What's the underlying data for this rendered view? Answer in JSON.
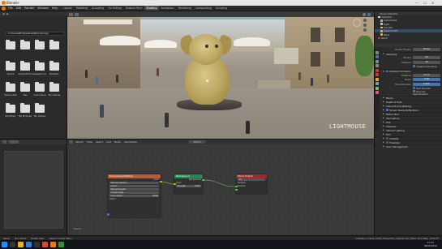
{
  "window": {
    "title": "Blender"
  },
  "window_controls": [
    "—",
    "☐",
    "✕"
  ],
  "menu": {
    "items": [
      "File",
      "Edit",
      "Render",
      "Window",
      "Help"
    ],
    "workspaces": [
      "Layout",
      "Modeling",
      "Sculpting",
      "UV Editing",
      "Texture Paint",
      "Shading",
      "Animation",
      "Rendering",
      "Compositing",
      "Scripting"
    ],
    "active_workspace": "Shading"
  },
  "file_browser": {
    "path": "C:\\Users\\Elli\\Desktop\\Blendering\\",
    "folders": [
      "",
      "",
      "",
      "",
      "Adobe",
      "AntiqueFolio",
      "Assassin's C...",
      "Bubbles",
      "Downloads",
      "iTax",
      "Insomnium",
      "My Games",
      "My Music",
      "My Pictures",
      "My Videos",
      "",
      "",
      ""
    ]
  },
  "viewport": {
    "watermark": "LIGHTMOUSE",
    "icons": [
      "select-box-icon",
      "view-icon",
      "shading-solid-icon",
      "shading-rendered-icon"
    ]
  },
  "outliner": {
    "header": "Scene Collection",
    "rows": [
      "Collection",
      "Camera.001",
      "Light",
      "Sun.001",
      "Suzanne.001",
      "Plane",
      "World"
    ]
  },
  "properties": {
    "render_engine_label": "Render Engine",
    "render_engine": "Eevee",
    "sampling": {
      "title": "Sampling",
      "render_label": "Render",
      "render_value": "64",
      "viewport_label": "Viewport",
      "viewport_value": "16",
      "denoise_label": "Viewport Denoising"
    },
    "ao": {
      "title": "Ambient Occlusion",
      "distance_label": "Distance",
      "distance_value": "0.2 m",
      "factor_label": "Factor",
      "factor_value": "1.00",
      "trace_label": "Trace Precision",
      "trace_value": "0.250",
      "bent_label": "Bent Normals",
      "bounces_label": "Bounces Approximation"
    },
    "sections": [
      "Bloom",
      "Depth of Field",
      "Subsurface Scattering",
      "Screen Space Reflections",
      "Motion Blur",
      "Volumetrics",
      "Hair",
      "Shadows",
      "Indirect Lighting",
      "Film",
      "Simplify",
      "Freestyle",
      "Color Management"
    ]
  },
  "node_editor": {
    "header_items": [
      "Object",
      "View",
      "Select",
      "Add",
      "Node",
      "Use Nodes"
    ],
    "material_slot": "World",
    "label": "World",
    "nodes": {
      "env": {
        "title": "Environment Texture",
        "output": "Color",
        "image": "DM-City-Gdansk...",
        "interp": "Linear",
        "proj": "Equirectangular",
        "source": "Single Image",
        "colorspace_label": "Color Space",
        "colorspace": "sRGB",
        "vector": "Vector"
      },
      "bg": {
        "title": "Background",
        "output": "Background",
        "color": "Color",
        "strength_label": "Strength",
        "strength_value": "1.000"
      },
      "out": {
        "title": "World Output",
        "dropdown": "All",
        "surface": "Surface",
        "volume": "Volume"
      }
    }
  },
  "status": {
    "select": "Select",
    "box_select": "Box Select",
    "rotate": "Rotate View",
    "context": "Object Context Menu",
    "stats": "Collection | Verts:1,000 | Faces:500 | Objects:1/4 | Mem: 42.0 MiB | v2.80.75"
  },
  "taskbar": {
    "time": "13:31",
    "date": "06/09/2019"
  },
  "colors": {
    "accent": "#e87d0d",
    "selection": "#4772b3",
    "node_env": "#c05a2a",
    "node_bg": "#1f8a4d",
    "node_out": "#a8242e"
  }
}
